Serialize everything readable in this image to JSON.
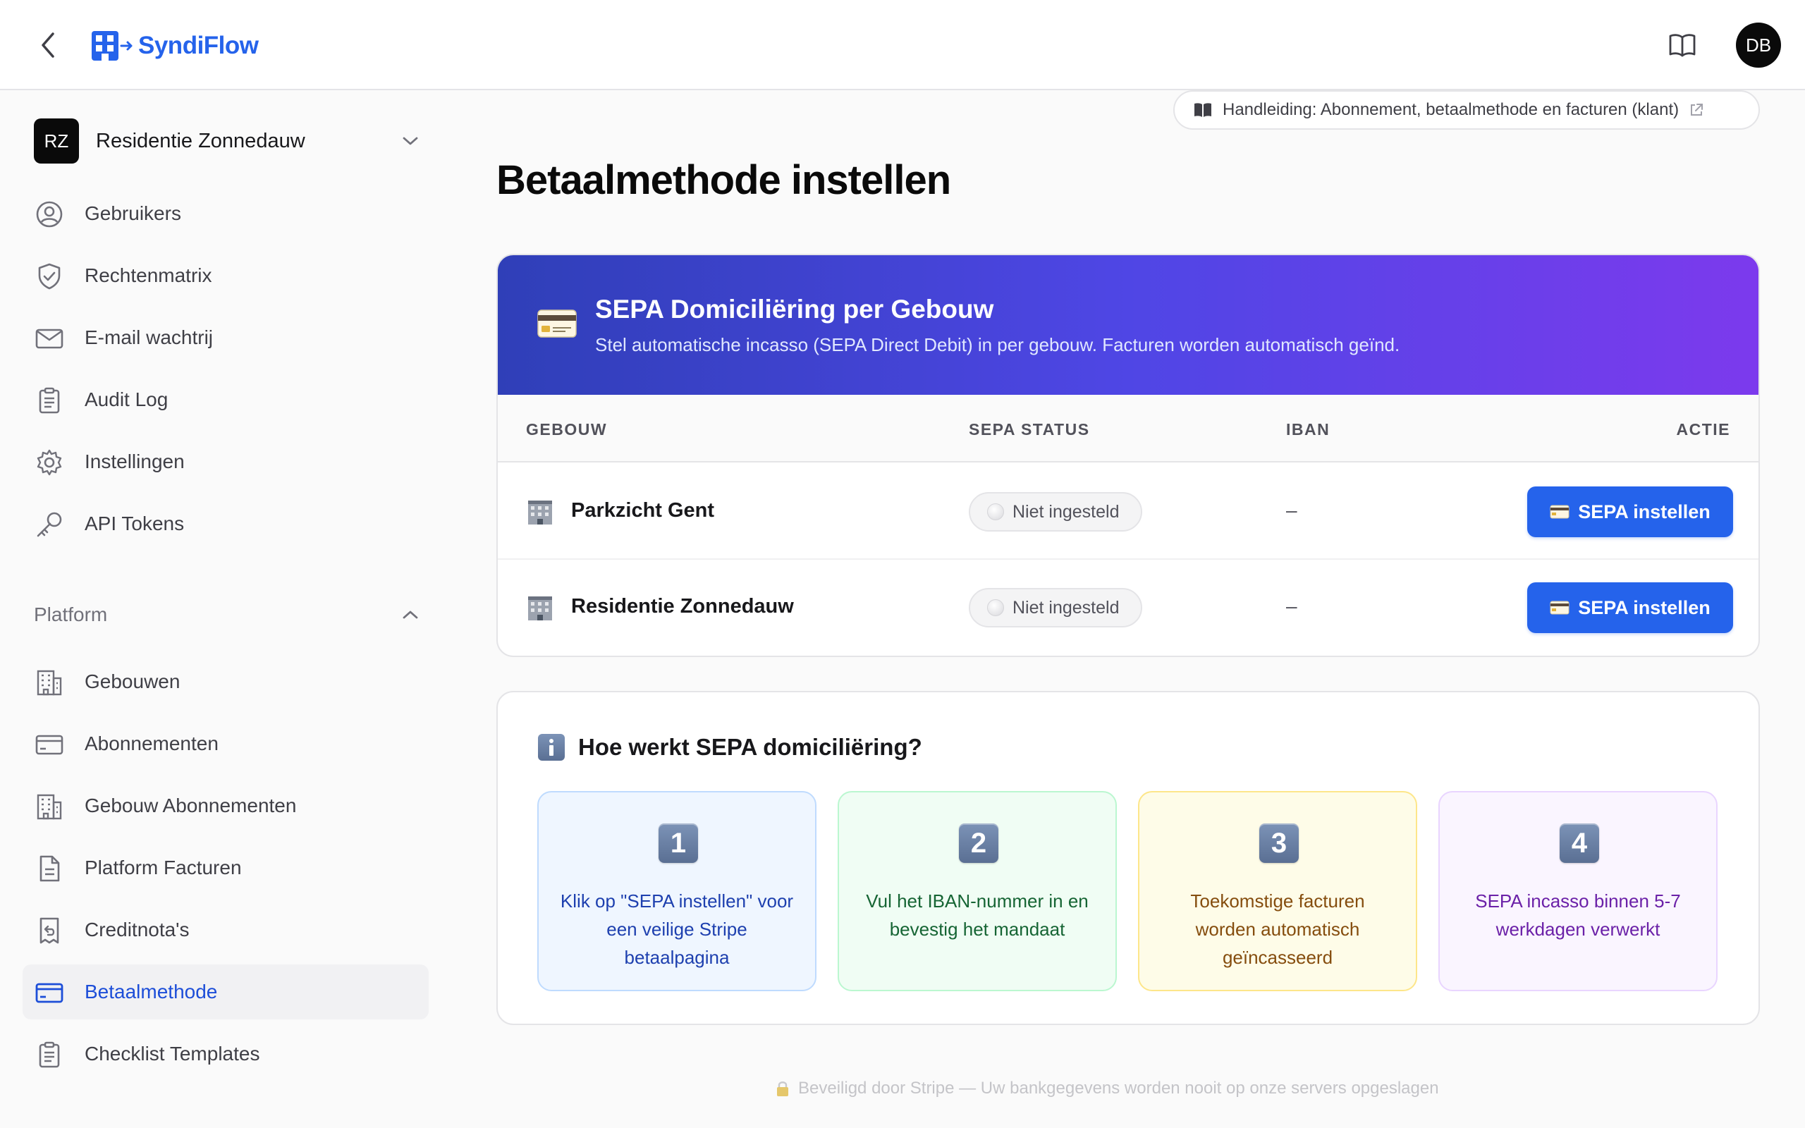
{
  "app": {
    "logo_text": "SyndiFlow",
    "avatar_initials": "DB",
    "brand_color": "#2563eb"
  },
  "sidebar": {
    "org": {
      "initials": "RZ",
      "name": "Residentie Zonnedauw"
    },
    "items": [
      {
        "label": "Gebruikers",
        "icon": "user-circle-icon"
      },
      {
        "label": "Rechtenmatrix",
        "icon": "shield-check-icon"
      },
      {
        "label": "E-mail wachtrij",
        "icon": "mail-icon"
      },
      {
        "label": "Audit Log",
        "icon": "clipboard-list-icon"
      },
      {
        "label": "Instellingen",
        "icon": "gear-icon"
      },
      {
        "label": "API Tokens",
        "icon": "key-icon"
      }
    ],
    "section_label": "Platform",
    "platform_items": [
      {
        "label": "Gebouwen",
        "icon": "building-icon"
      },
      {
        "label": "Abonnementen",
        "icon": "credit-card-icon"
      },
      {
        "label": "Gebouw Abonnementen",
        "icon": "building-icon"
      },
      {
        "label": "Platform Facturen",
        "icon": "file-text-icon"
      },
      {
        "label": "Creditnota's",
        "icon": "receipt-undo-icon"
      },
      {
        "label": "Betaalmethode",
        "icon": "credit-card-icon",
        "active": true
      },
      {
        "label": "Checklist Templates",
        "icon": "clipboard-list-icon"
      }
    ]
  },
  "main": {
    "guide_link": "Handleiding: Abonnement, betaalmethode en facturen (klant)",
    "page_title": "Betaalmethode instellen",
    "sepa_card": {
      "title": "SEPA Domiciliëring per Gebouw",
      "subtitle": "Stel automatische incasso (SEPA Direct Debit) in per gebouw. Facturen worden automatisch geïnd.",
      "columns": {
        "building": "GEBOUW",
        "status": "SEPA STATUS",
        "iban": "IBAN",
        "action": "ACTIE"
      },
      "rows": [
        {
          "building": "Parkzicht Gent",
          "status": "Niet ingesteld",
          "iban": "–",
          "action": "SEPA instellen"
        },
        {
          "building": "Residentie Zonnedauw",
          "status": "Niet ingesteld",
          "iban": "–",
          "action": "SEPA instellen"
        }
      ]
    },
    "info_card": {
      "title": "Hoe werkt SEPA domiciliëring?",
      "steps": [
        {
          "num": "1",
          "text": "Klik op \"SEPA instellen\" voor een veilige Stripe betaalpagina"
        },
        {
          "num": "2",
          "text": "Vul het IBAN-nummer in en bevestig het mandaat"
        },
        {
          "num": "3",
          "text": "Toekomstige facturen worden automatisch geïncasseerd"
        },
        {
          "num": "4",
          "text": "SEPA incasso binnen 5-7 werkdagen verwerkt"
        }
      ]
    },
    "footer_note": "Beveiligd door Stripe — Uw bankgegevens worden nooit op onze servers opgeslagen"
  }
}
